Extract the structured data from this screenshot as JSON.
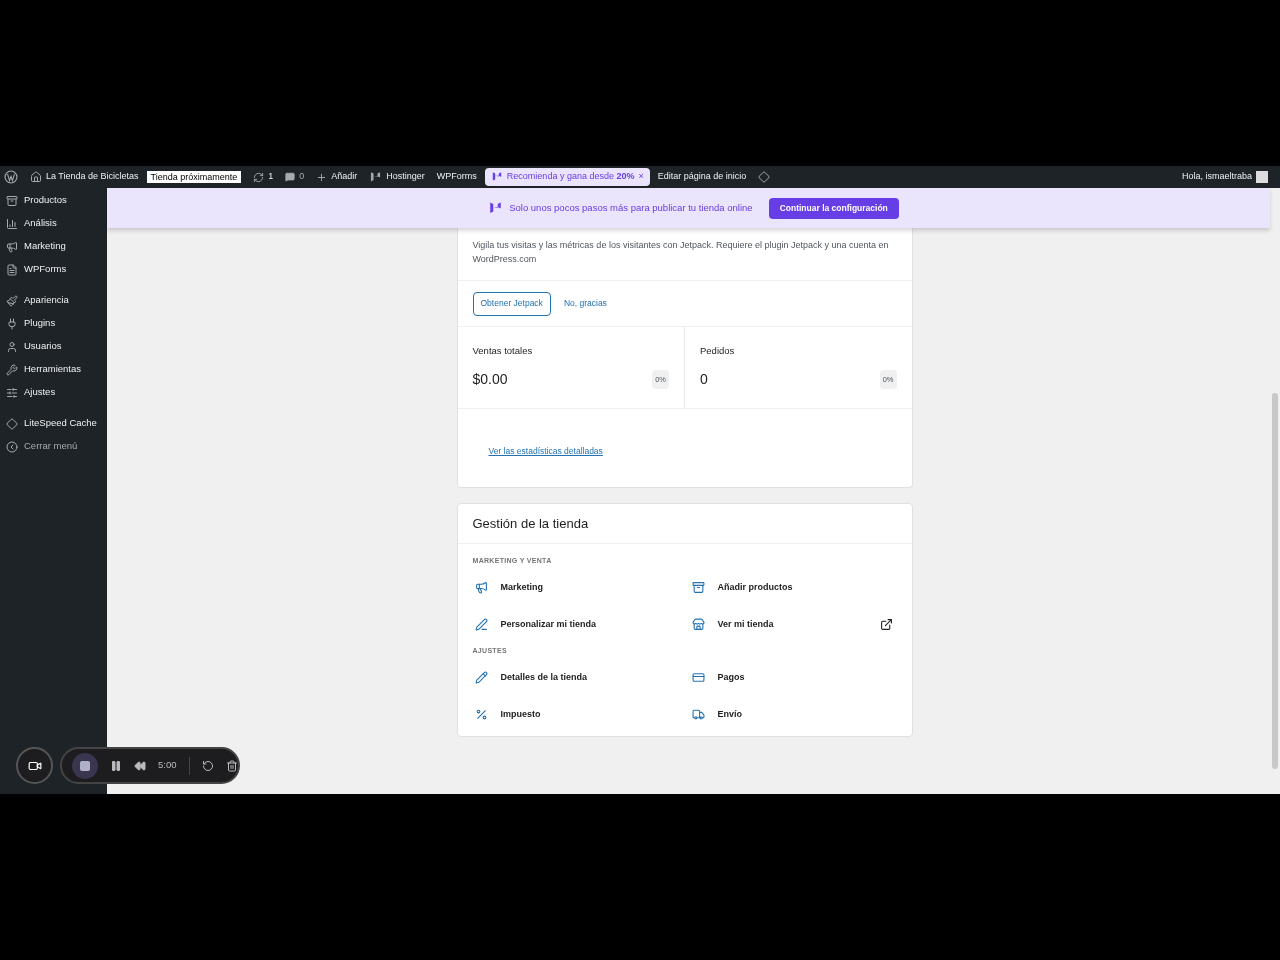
{
  "admin_bar": {
    "site_name": "La Tienda de Bicicletas",
    "status_badge": "Tienda próximamente",
    "updates_count": "1",
    "comments_count": "0",
    "add_label": "Añadir",
    "hostinger_label": "Hostinger",
    "wpforms_label": "WPForms",
    "promo": {
      "text": "Recomienda y gana desde **20%**",
      "close": "×"
    },
    "edit_label": "Editar página de inicio",
    "greeting": "Hola, ismaeltraba"
  },
  "sidebar": {
    "groups": [
      {
        "items": [
          {
            "label": "Productos"
          },
          {
            "label": "Análisis"
          },
          {
            "label": "Marketing"
          },
          {
            "label": "WPForms"
          }
        ]
      },
      {
        "items": [
          {
            "label": "Apariencia"
          },
          {
            "label": "Plugins"
          },
          {
            "label": "Usuarios"
          },
          {
            "label": "Herramientas"
          },
          {
            "label": "Ajustes"
          }
        ]
      },
      {
        "items": [
          {
            "label": "LiteSpeed Cache"
          },
          {
            "label": "Cerrar menú",
            "kind": "collapse"
          }
        ]
      }
    ]
  },
  "banner": {
    "text": "Solo unos pocos pasos más para publicar tu tienda online",
    "button": "Continuar la configuración"
  },
  "stats_card": {
    "description": "Vigila tus visitas y las métricas de los visitantes con Jetpack. Requiere el plugin Jetpack y una cuenta en WordPress.com",
    "primary_button": "Obtener Jetpack",
    "secondary_link": "No, gracias",
    "metrics": [
      {
        "label": "Ventas totales",
        "value": "$0.00",
        "delta": "0%"
      },
      {
        "label": "Pedidos",
        "value": "0",
        "delta": "0%"
      }
    ],
    "link": "Ver las estadísticas detalladas"
  },
  "store_card": {
    "title": "Gestión de la tienda",
    "sections": [
      {
        "heading": "MARKETING Y VENTA",
        "items": [
          {
            "label": "Marketing",
            "external": false
          },
          {
            "label": "Añadir productos",
            "external": false
          },
          {
            "label": "Personalizar mi tienda",
            "external": false
          },
          {
            "label": "Ver mi tienda",
            "external": true
          }
        ]
      },
      {
        "heading": "AJUSTES",
        "items": [
          {
            "label": "Detalles de la tienda",
            "external": false
          },
          {
            "label": "Pagos",
            "external": false
          },
          {
            "label": "Impuesto",
            "external": false
          },
          {
            "label": "Envío",
            "external": false
          }
        ]
      }
    ]
  },
  "recorder": {
    "time": "5:00"
  }
}
